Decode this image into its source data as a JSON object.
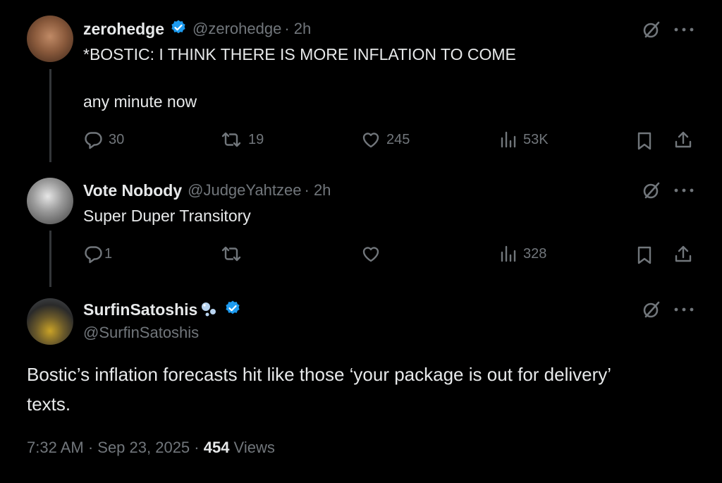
{
  "tweets": [
    {
      "display_name": "zerohedge",
      "handle": "@zerohedge",
      "time": "· 2h",
      "text_lines": [
        "*BOSTIC: I THINK THERE IS MORE INFLATION TO COME",
        "any minute now"
      ],
      "replies": "30",
      "retweets": "19",
      "likes": "245",
      "views": "53K"
    },
    {
      "display_name": "Vote Nobody",
      "handle": "@JudgeYahtzee",
      "time": "· 2h",
      "text_lines": [
        "Super Duper Transitory"
      ],
      "replies": "1",
      "retweets": "",
      "likes": "",
      "views": "328"
    }
  ],
  "main_tweet": {
    "display_name": "SurfinSatoshis",
    "handle": "@SurfinSatoshis",
    "text_line1": "Bostic’s inflation forecasts hit like those ‘your package is out for delivery’",
    "text_line2": "texts.",
    "timestamp": "7:32 AM · Sep 23, 2025 · ",
    "views_count": "454",
    "views_label": " Views"
  },
  "colors": {
    "background": "#000000",
    "text": "#e7e9ea",
    "muted": "#71767b",
    "verified": "#1d9bf0",
    "thread_line": "#333639"
  },
  "icons": [
    "reply-icon",
    "retweet-icon",
    "like-icon",
    "views-icon",
    "bookmark-icon",
    "share-icon",
    "grok-icon",
    "more-icon",
    "verified-badge-icon"
  ]
}
